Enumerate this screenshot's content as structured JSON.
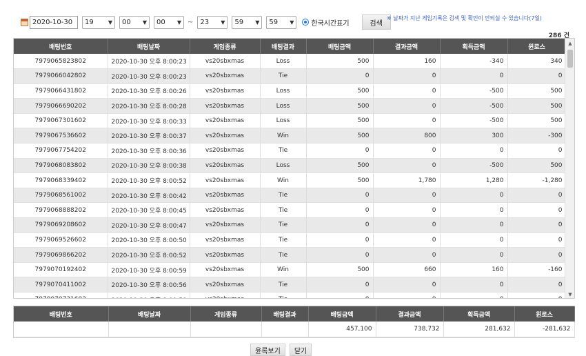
{
  "filter": {
    "start_date": "2020-10-30",
    "start_hour": "19",
    "start_min": "00",
    "start_sec": "00",
    "range_sep": "~",
    "end_hour": "23",
    "end_min": "59",
    "end_sec": "59",
    "timezone_label": "한국시간표기",
    "search_label": "검색"
  },
  "notice": "※ 날짜가 지난 게임기록은 검색 및 확인이 안되실 수 있습니다(7일)",
  "count": "286 건",
  "columns": [
    "배팅번호",
    "배팅날짜",
    "게임종류",
    "배팅결과",
    "배팅금액",
    "결과금액",
    "획득금액",
    "윈로스"
  ],
  "rows": [
    [
      "7979065823802",
      "2020-10-30 오후 8:00:23",
      "vs20sbxmas",
      "Loss",
      "500",
      "160",
      "-340",
      "340"
    ],
    [
      "7979066042802",
      "2020-10-30 오후 8:00:23",
      "vs20sbxmas",
      "Tie",
      "0",
      "0",
      "0",
      "0"
    ],
    [
      "7979066431802",
      "2020-10-30 오후 8:00:26",
      "vs20sbxmas",
      "Loss",
      "500",
      "0",
      "-500",
      "500"
    ],
    [
      "7979066690202",
      "2020-10-30 오후 8:00:28",
      "vs20sbxmas",
      "Loss",
      "500",
      "0",
      "-500",
      "500"
    ],
    [
      "7979067301602",
      "2020-10-30 오후 8:00:33",
      "vs20sbxmas",
      "Loss",
      "500",
      "0",
      "-500",
      "500"
    ],
    [
      "7979067536602",
      "2020-10-30 오후 8:00:37",
      "vs20sbxmas",
      "Win",
      "500",
      "800",
      "300",
      "-300"
    ],
    [
      "7979067754202",
      "2020-10-30 오후 8:00:36",
      "vs20sbxmas",
      "Tie",
      "0",
      "0",
      "0",
      "0"
    ],
    [
      "7979068083802",
      "2020-10-30 오후 8:00:38",
      "vs20sbxmas",
      "Loss",
      "500",
      "0",
      "-500",
      "500"
    ],
    [
      "7979068339402",
      "2020-10-30 오후 8:00:52",
      "vs20sbxmas",
      "Win",
      "500",
      "1,780",
      "1,280",
      "-1,280"
    ],
    [
      "7979068561002",
      "2020-10-30 오후 8:00:42",
      "vs20sbxmas",
      "Tie",
      "0",
      "0",
      "0",
      "0"
    ],
    [
      "7979068888202",
      "2020-10-30 오후 8:00:45",
      "vs20sbxmas",
      "Tie",
      "0",
      "0",
      "0",
      "0"
    ],
    [
      "7979069208602",
      "2020-10-30 오후 8:00:47",
      "vs20sbxmas",
      "Tie",
      "0",
      "0",
      "0",
      "0"
    ],
    [
      "7979069526602",
      "2020-10-30 오후 8:00:50",
      "vs20sbxmas",
      "Tie",
      "0",
      "0",
      "0",
      "0"
    ],
    [
      "7979069866202",
      "2020-10-30 오후 8:00:52",
      "vs20sbxmas",
      "Tie",
      "0",
      "0",
      "0",
      "0"
    ],
    [
      "7979070192402",
      "2020-10-30 오후 8:00:59",
      "vs20sbxmas",
      "Win",
      "500",
      "660",
      "160",
      "-160"
    ],
    [
      "7979070411002",
      "2020-10-30 오후 8:00:56",
      "vs20sbxmas",
      "Tie",
      "0",
      "0",
      "0",
      "0"
    ],
    [
      "7979070731602",
      "2020-10-30 오후 8:00:59",
      "vs20sbxmas",
      "Tie",
      "0",
      "0",
      "0",
      "0"
    ]
  ],
  "summary": {
    "columns": [
      "배팅번호",
      "배팅날짜",
      "게임종류",
      "배팅결과",
      "배팅금액",
      "결과금액",
      "획득금액",
      "윈로스"
    ],
    "values": [
      "",
      "",
      "",
      "",
      "457,100",
      "738,732",
      "281,632",
      "-281,632"
    ]
  },
  "bottom_buttons": [
    "윤록보기",
    "닫기"
  ],
  "icons": {
    "calendar": "calendar-icon",
    "chevron": "chevron-down-icon",
    "radio": "radio-selected-icon",
    "scroll_up": "scroll-up-icon",
    "scroll_down": "scroll-down-icon"
  },
  "colors": {
    "header_bg": "#555555",
    "row_alt_bg": "#e9e9e9",
    "notice_text": "#3a5fc8",
    "radio_accent": "#1a73e8"
  }
}
